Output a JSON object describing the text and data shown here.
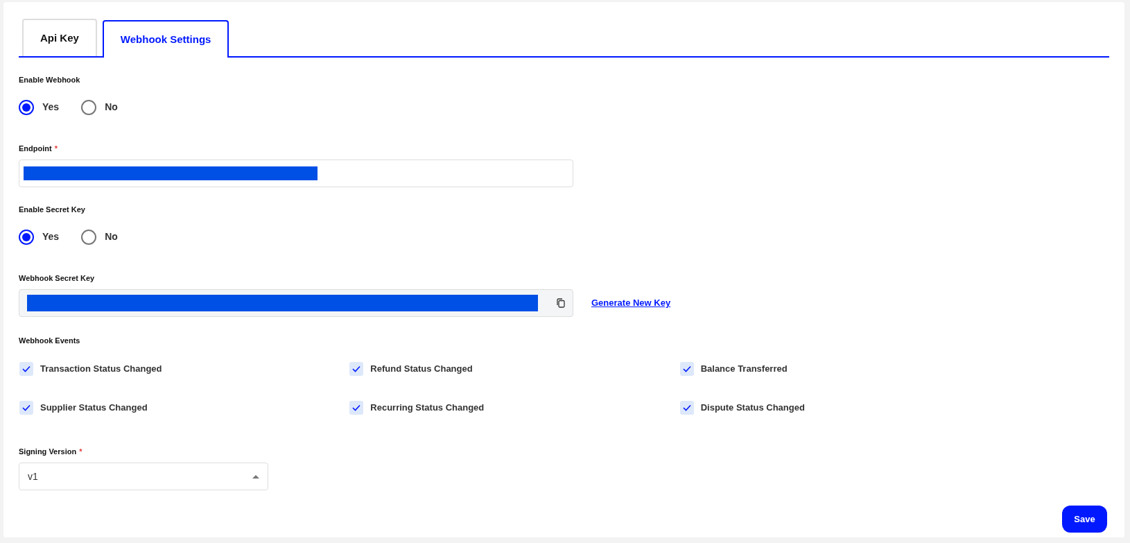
{
  "tabs": [
    {
      "label": "Api Key",
      "selected": false
    },
    {
      "label": "Webhook Settings",
      "selected": true
    }
  ],
  "enable_webhook": {
    "label": "Enable Webhook",
    "options": [
      {
        "label": "Yes",
        "selected": true
      },
      {
        "label": "No",
        "selected": false
      }
    ]
  },
  "endpoint": {
    "label": "Endpoint",
    "required": "*"
  },
  "enable_secret_key": {
    "label": "Enable Secret Key",
    "options": [
      {
        "label": "Yes",
        "selected": true
      },
      {
        "label": "No",
        "selected": false
      }
    ]
  },
  "secret_key": {
    "label": "Webhook Secret Key",
    "link": "Generate New Key"
  },
  "webhook_events": {
    "label": "Webhook Events",
    "items": [
      {
        "label": "Transaction Status Changed",
        "checked": true
      },
      {
        "label": "Refund Status Changed",
        "checked": true
      },
      {
        "label": "Balance Transferred",
        "checked": true
      },
      {
        "label": "Supplier Status Changed",
        "checked": true
      },
      {
        "label": "Recurring Status Changed",
        "checked": true
      },
      {
        "label": "Dispute Status Changed",
        "checked": true
      }
    ]
  },
  "signing_version": {
    "label": "Signing Version",
    "required": "*",
    "value": "v1"
  },
  "buttons": [
    "Save"
  ]
}
